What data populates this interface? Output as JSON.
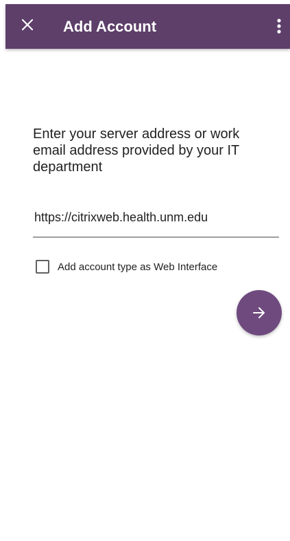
{
  "app_bar": {
    "title": "Add Account",
    "close_icon": "close-icon",
    "overflow_icon": "more-vert-icon",
    "color": "#5d3f6a"
  },
  "form": {
    "prompt": "Enter your server address or work email address provided by your IT department",
    "server_input_value": "https://citrixweb.health.unm.edu",
    "checkbox_label": "Add account type as Web Interface",
    "checkbox_checked": false,
    "next_icon": "arrow-right-icon",
    "next_button_color": "#6f4a7f"
  }
}
